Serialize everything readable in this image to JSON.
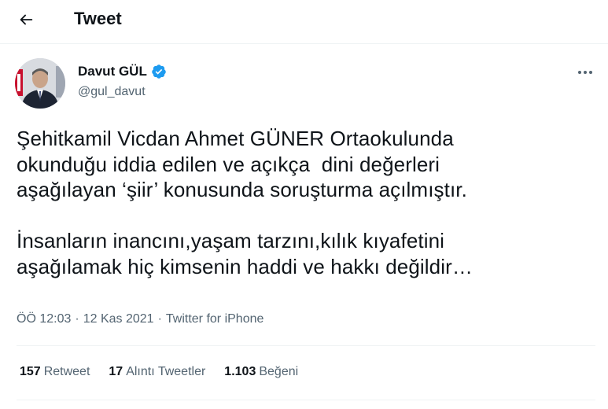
{
  "header": {
    "title": "Tweet",
    "back_icon": "arrow-left-icon"
  },
  "tweet": {
    "author_name": "Davut GÜL",
    "handle": "@gul_davut",
    "verified_icon": "verified-badge-icon",
    "more_icon": "more-horizontal-icon",
    "text": "Şehitkamil Vicdan Ahmet GÜNER Ortaokulunda\nokunduğu iddia edilen ve açıkça  dini değerleri\naşağılayan ‘şiir’ konusunda soruşturma açılmıştır.\n\nİnsanların inancını,yaşam tarzını,kılık kıyafetini\naşağılamak hiç kimsenin haddi ve hakkı değildir…",
    "time": "ÖÖ 12:03",
    "date": "12 Kas 2021",
    "source": "Twitter for iPhone",
    "separator": "·"
  },
  "stats": {
    "retweets": {
      "count": "157",
      "label": "Retweet"
    },
    "quotes": {
      "count": "17",
      "label": "Alıntı Tweetler"
    },
    "likes": {
      "count": "1.103",
      "label": "Beğeni"
    }
  },
  "colors": {
    "text": "#0f1419",
    "secondary": "#536471",
    "verified": "#1d9bf0",
    "divider": "#eff3f4"
  }
}
